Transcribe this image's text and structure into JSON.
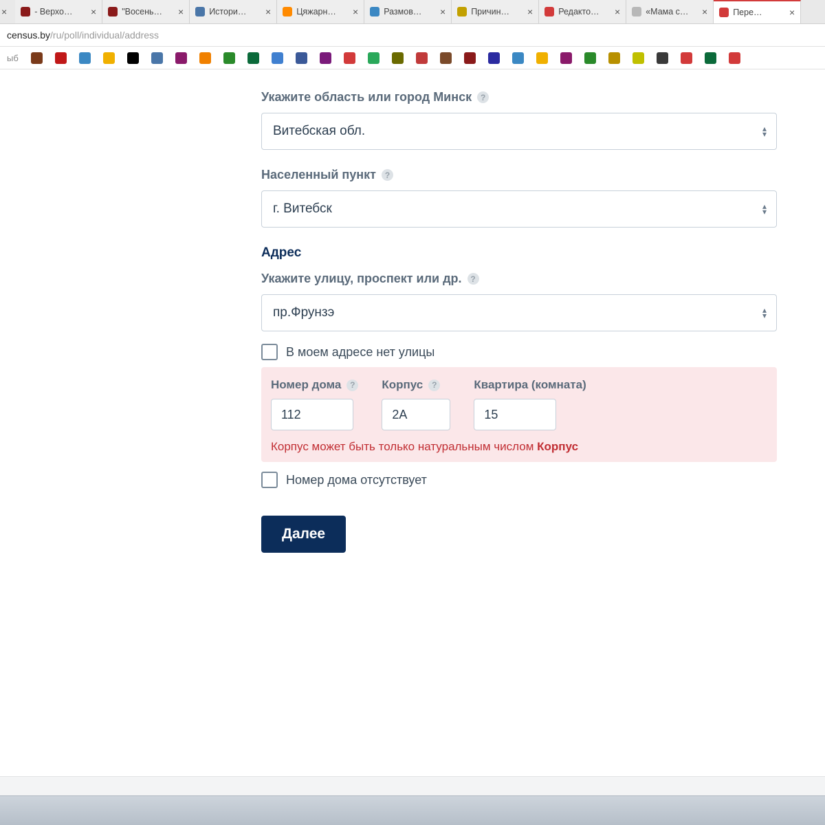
{
  "browser": {
    "tabs": [
      {
        "label": "- Верхо…",
        "icon_color": "#8a1a1a"
      },
      {
        "label": "\"Восень…",
        "icon_color": "#8a1a1a"
      },
      {
        "label": "Истори…",
        "icon_color": "#4a76a8"
      },
      {
        "label": "Цяжарн…",
        "icon_color": "#ff8a00"
      },
      {
        "label": "Размов…",
        "icon_color": "#3b88c3"
      },
      {
        "label": "Причин…",
        "icon_color": "#c2a000"
      },
      {
        "label": "Редакто…",
        "icon_color": "#d23a3a"
      },
      {
        "label": "«Мама с…",
        "icon_color": "#b8b8b8"
      },
      {
        "label": "Пере…",
        "icon_color": "#d23a3a",
        "active": true
      }
    ],
    "url_host": "census.by",
    "url_path": "/ru/poll/individual/address",
    "bookmarks_prefix": "ыб",
    "bookmark_colors": [
      "#7a3a1a",
      "#c01818",
      "#3b88c3",
      "#f0b000",
      "#000000",
      "#4a76a8",
      "#8a1a6a",
      "#f08000",
      "#2a8a2a",
      "#0b6a3a",
      "#4080d0",
      "#3b5998",
      "#7a1a7a",
      "#d23a3a",
      "#2aa85a",
      "#6a6a00",
      "#c03a3a",
      "#7a4a2a",
      "#8a1a1a",
      "#2a2aa0",
      "#3b88c3",
      "#f0b000",
      "#8a1a6a",
      "#2a8a2a",
      "#b89000",
      "#c0c000",
      "#3a3a3a",
      "#d23a3a",
      "#0b6a3a",
      "#d23a3a"
    ]
  },
  "form": {
    "region_label": "Укажите область или город Минск",
    "region_value": "Витебская обл.",
    "locality_label": "Населенный пункт",
    "locality_value": "г. Витебск",
    "address_title": "Адрес",
    "street_label": "Укажите улицу, проспект или др.",
    "street_value": "пр.Фрунзэ",
    "no_street_label": "В моем адресе нет улицы",
    "house_label": "Номер дома",
    "house_value": "112",
    "corpus_label": "Корпус",
    "corpus_value": "2А",
    "flat_label": "Квартира (комната)",
    "flat_value": "15",
    "error_text": "Корпус может быть только натуральным числом",
    "error_field": "Корпус",
    "no_house_label": "Номер дома отсутствует",
    "next_label": "Далее"
  }
}
